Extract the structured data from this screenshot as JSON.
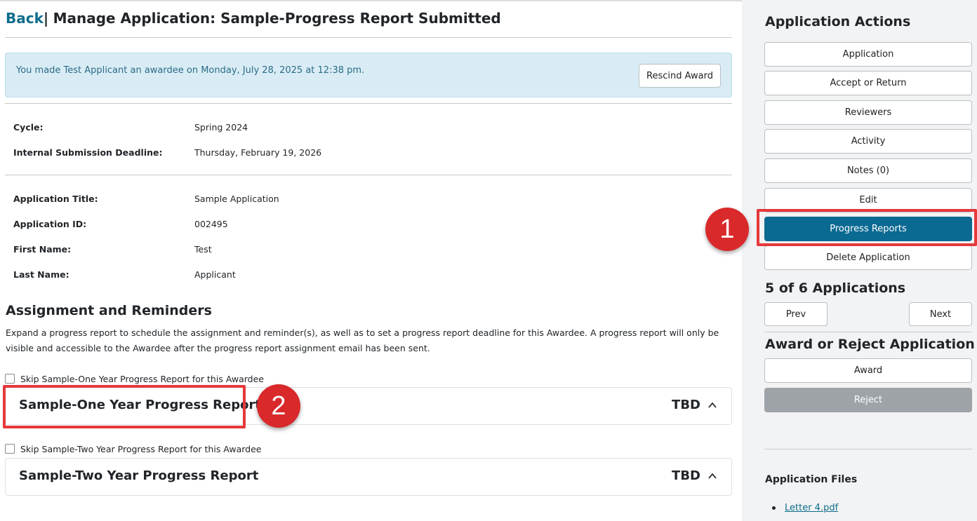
{
  "header": {
    "back_label": "Back",
    "separator": "|",
    "title": "Manage Application: Sample-Progress Report Submitted"
  },
  "alert": {
    "message": "You made Test Applicant an awardee on Monday, July 28, 2025 at 12:38 pm.",
    "rescind_label": "Rescind Award"
  },
  "details": {
    "cycle": {
      "label": "Cycle:",
      "value": "Spring 2024"
    },
    "deadline": {
      "label": "Internal Submission Deadline:",
      "value": "Thursday, February 19, 2026"
    },
    "app_title": {
      "label": "Application Title:",
      "value": "Sample Application"
    },
    "app_id": {
      "label": "Application ID:",
      "value": "002495"
    },
    "first_name": {
      "label": "First Name:",
      "value": "Test"
    },
    "last_name": {
      "label": "Last Name:",
      "value": "Applicant"
    }
  },
  "assignment": {
    "heading": "Assignment and Reminders",
    "description": "Expand a progress report to schedule the assignment and reminder(s), as well as to set a progress report deadline for this Awardee. A progress report will only be visible and accessible to the Awardee after the progress report assignment email has been sent.",
    "reports": [
      {
        "skip_label": "Skip Sample-One Year Progress Report for this Awardee",
        "title": "Sample-One Year Progress Report",
        "status": "TBD"
      },
      {
        "skip_label": "Skip Sample-Two Year Progress Report for this Awardee",
        "title": "Sample-Two Year Progress Report",
        "status": "TBD"
      }
    ]
  },
  "sidebar": {
    "actions_heading": "Application Actions",
    "actions": [
      "Application",
      "Accept or Return",
      "Reviewers",
      "Activity",
      "Notes (0)",
      "Edit",
      "Progress Reports",
      "Delete Application"
    ],
    "pagination_heading": "5 of 6 Applications",
    "prev_label": "Prev",
    "next_label": "Next",
    "award_heading": "Award or Reject Application",
    "award_label": "Award",
    "reject_label": "Reject",
    "files_heading": "Application Files",
    "files": [
      "Letter 4.pdf"
    ]
  },
  "annotations": {
    "badge_1": "1",
    "badge_2": "2"
  },
  "colors": {
    "accent": "#0b6a92",
    "link": "#0e6d8c",
    "alert_bg": "#d9ecf5",
    "highlight": "#e4393b"
  }
}
